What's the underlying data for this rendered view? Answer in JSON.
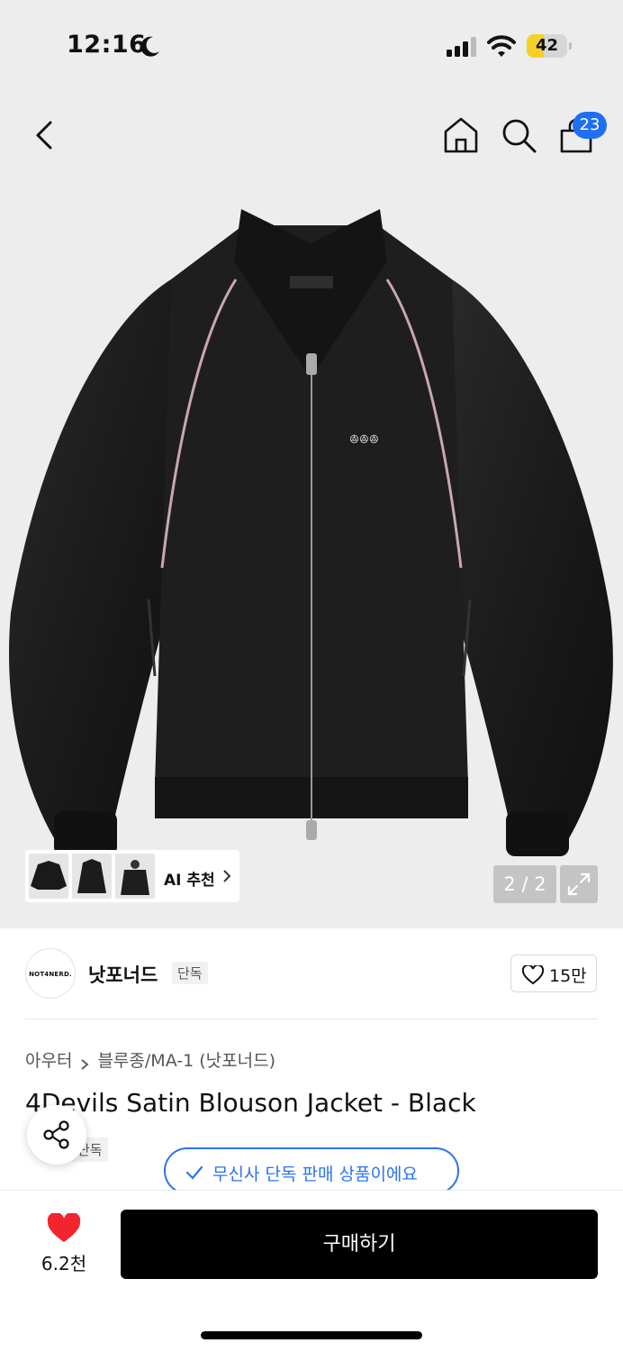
{
  "status_bar": {
    "time": "12:16",
    "battery": "42",
    "battery_level": 0.42
  },
  "nav": {
    "cart_count": "23",
    "icons": [
      "back-icon",
      "home-icon",
      "search-icon",
      "cart-icon"
    ]
  },
  "gallery": {
    "ai_label": "AI 추천",
    "page_indicator": "2 / 2"
  },
  "logo_text": "NOT4NERD.",
  "brand": {
    "name": "낫포너드",
    "tag": "단독",
    "likes": "15만"
  },
  "breadcrumb": {
    "category": "아우터",
    "subcategory": "블루종/MA-1 (낫포너드)"
  },
  "product": {
    "title": "4Devils Satin Blouson Jacket - Black",
    "tag": "단독"
  },
  "exclusive_notice": "무신사 단독 판매 상품이에요",
  "bottom": {
    "like_count": "6.2천",
    "buy_label": "구매하기"
  },
  "colors": {
    "accent_blue": "#1f6ff5",
    "heart_red": "#f2242d",
    "buy_bg": "#000000"
  }
}
